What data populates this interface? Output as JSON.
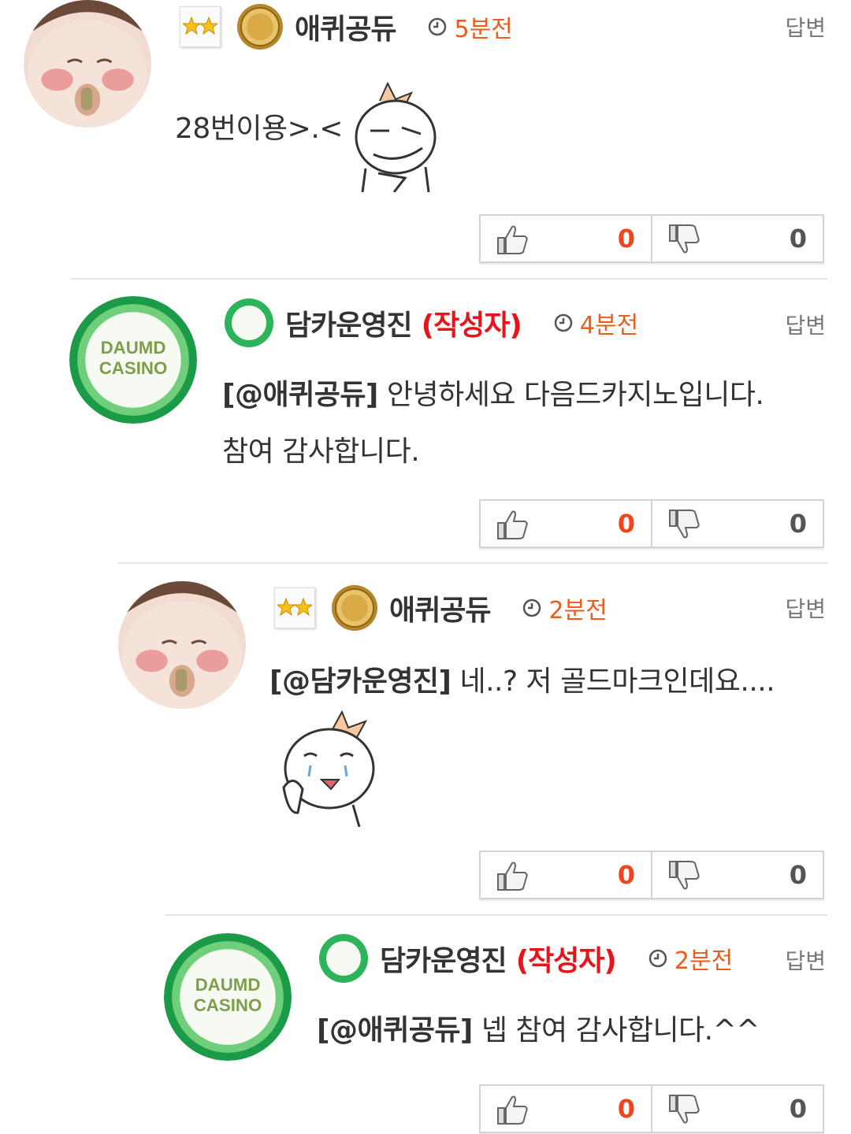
{
  "comments": [
    {
      "username": "애퀴공듀",
      "author_tag": "",
      "time": "5분전",
      "reply_label": "답변",
      "text_mention": "",
      "text_body": "28번이용>.<",
      "likes": "0",
      "dislikes": "0"
    },
    {
      "username": "담카운영진",
      "author_tag": "(작성자)",
      "time": "4분전",
      "reply_label": "답변",
      "text_mention": "[@애퀴공듀]",
      "text_body": " 안녕하세요 다음드카지노입니다.",
      "text_line2": "참여 감사합니다.",
      "likes": "0",
      "dislikes": "0",
      "avatar_text_1": "DAUMD",
      "avatar_text_2": "CASINO"
    },
    {
      "username": "애퀴공듀",
      "author_tag": "",
      "time": "2분전",
      "reply_label": "답변",
      "text_mention": "[@담카운영진]",
      "text_body": " 네..? 저 골드마크인데요....",
      "likes": "0",
      "dislikes": "0"
    },
    {
      "username": "담카운영진",
      "author_tag": "(작성자)",
      "time": "2분전",
      "reply_label": "답변",
      "text_mention": "[@애퀴공듀]",
      "text_body": " 넵 참여 감사합니다.^^",
      "likes": "0",
      "dislikes": "0",
      "avatar_text_1": "DAUMD",
      "avatar_text_2": "CASINO"
    }
  ],
  "colors": {
    "time": "#f05a1a",
    "author_tag": "#e8141c",
    "like_count": "#f0451e"
  }
}
